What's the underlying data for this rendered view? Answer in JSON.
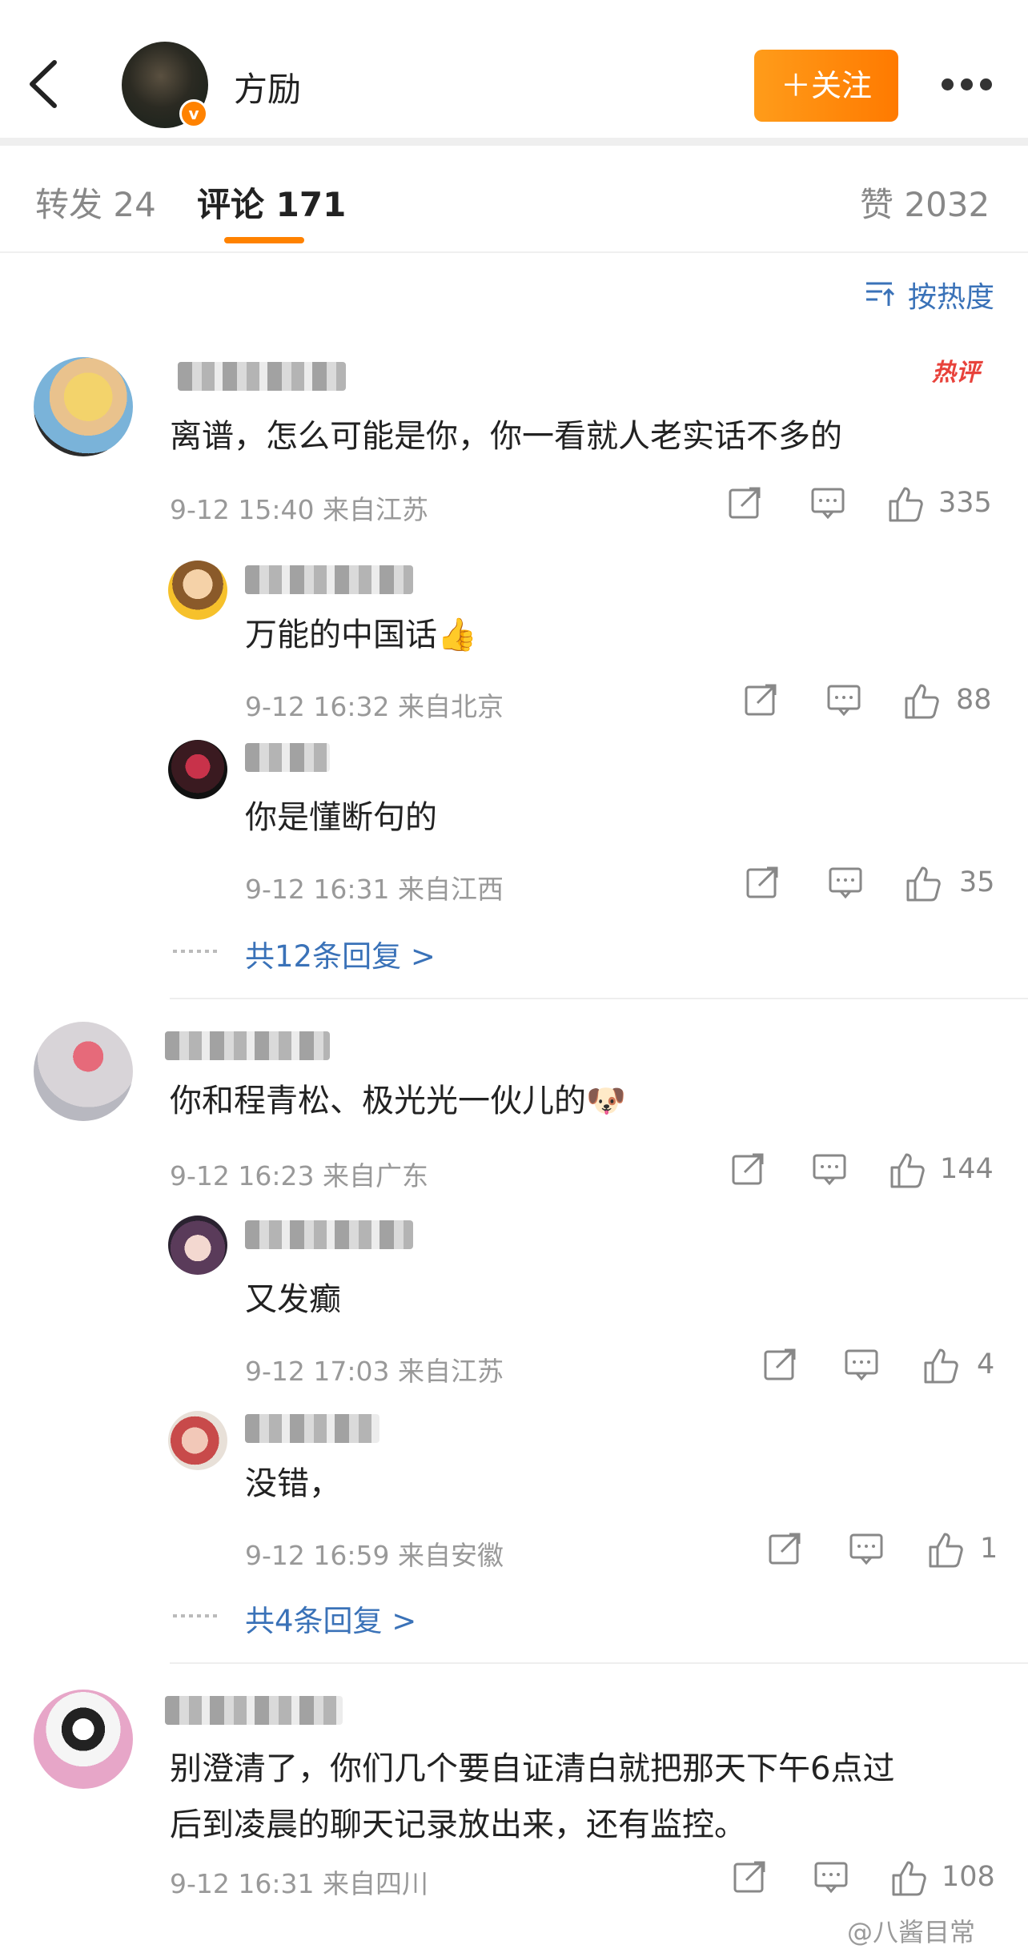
{
  "header": {
    "username": "方励",
    "follow_label": "＋关注",
    "verified_badge": "v"
  },
  "tabs": [
    {
      "label": "转发 24"
    },
    {
      "label": "评论 171"
    },
    {
      "label": "赞 2032"
    }
  ],
  "sort": {
    "label": "按热度"
  },
  "hot_badge": "热评",
  "comments": [
    {
      "text": "离谱，怎么可能是你，你一看就人老实话不多的",
      "meta": "9-12 15:40 来自江苏",
      "likes": "335",
      "replies": [
        {
          "text": "万能的中国话👍",
          "meta": "9-12 16:32 来自北京",
          "likes": "88"
        },
        {
          "text": "你是懂断句的",
          "meta": "9-12 16:31 来自江西",
          "likes": "35"
        }
      ],
      "more_replies": "共12条回复 >"
    },
    {
      "text": "你和程青松、极光光一伙儿的🐶",
      "meta": "9-12 16:23 来自广东",
      "likes": "144",
      "replies": [
        {
          "text": "又发癫",
          "meta": "9-12 17:03 来自江苏",
          "likes": "4"
        },
        {
          "text": "没错，",
          "meta": "9-12 16:59 来自安徽",
          "likes": "1"
        }
      ],
      "more_replies": "共4条回复 >"
    },
    {
      "text_line1": "别澄清了，你们几个要自证清白就把那天下午6点过",
      "text_line2": "后到凌晨的聊天记录放出来，还有监控。",
      "meta": "9-12 16:31 来自四川",
      "likes": "108"
    }
  ],
  "watermark": "@八酱目常",
  "colors": {
    "accent": "#ff8200",
    "link": "#3a72b8",
    "hot": "#e8423b"
  }
}
